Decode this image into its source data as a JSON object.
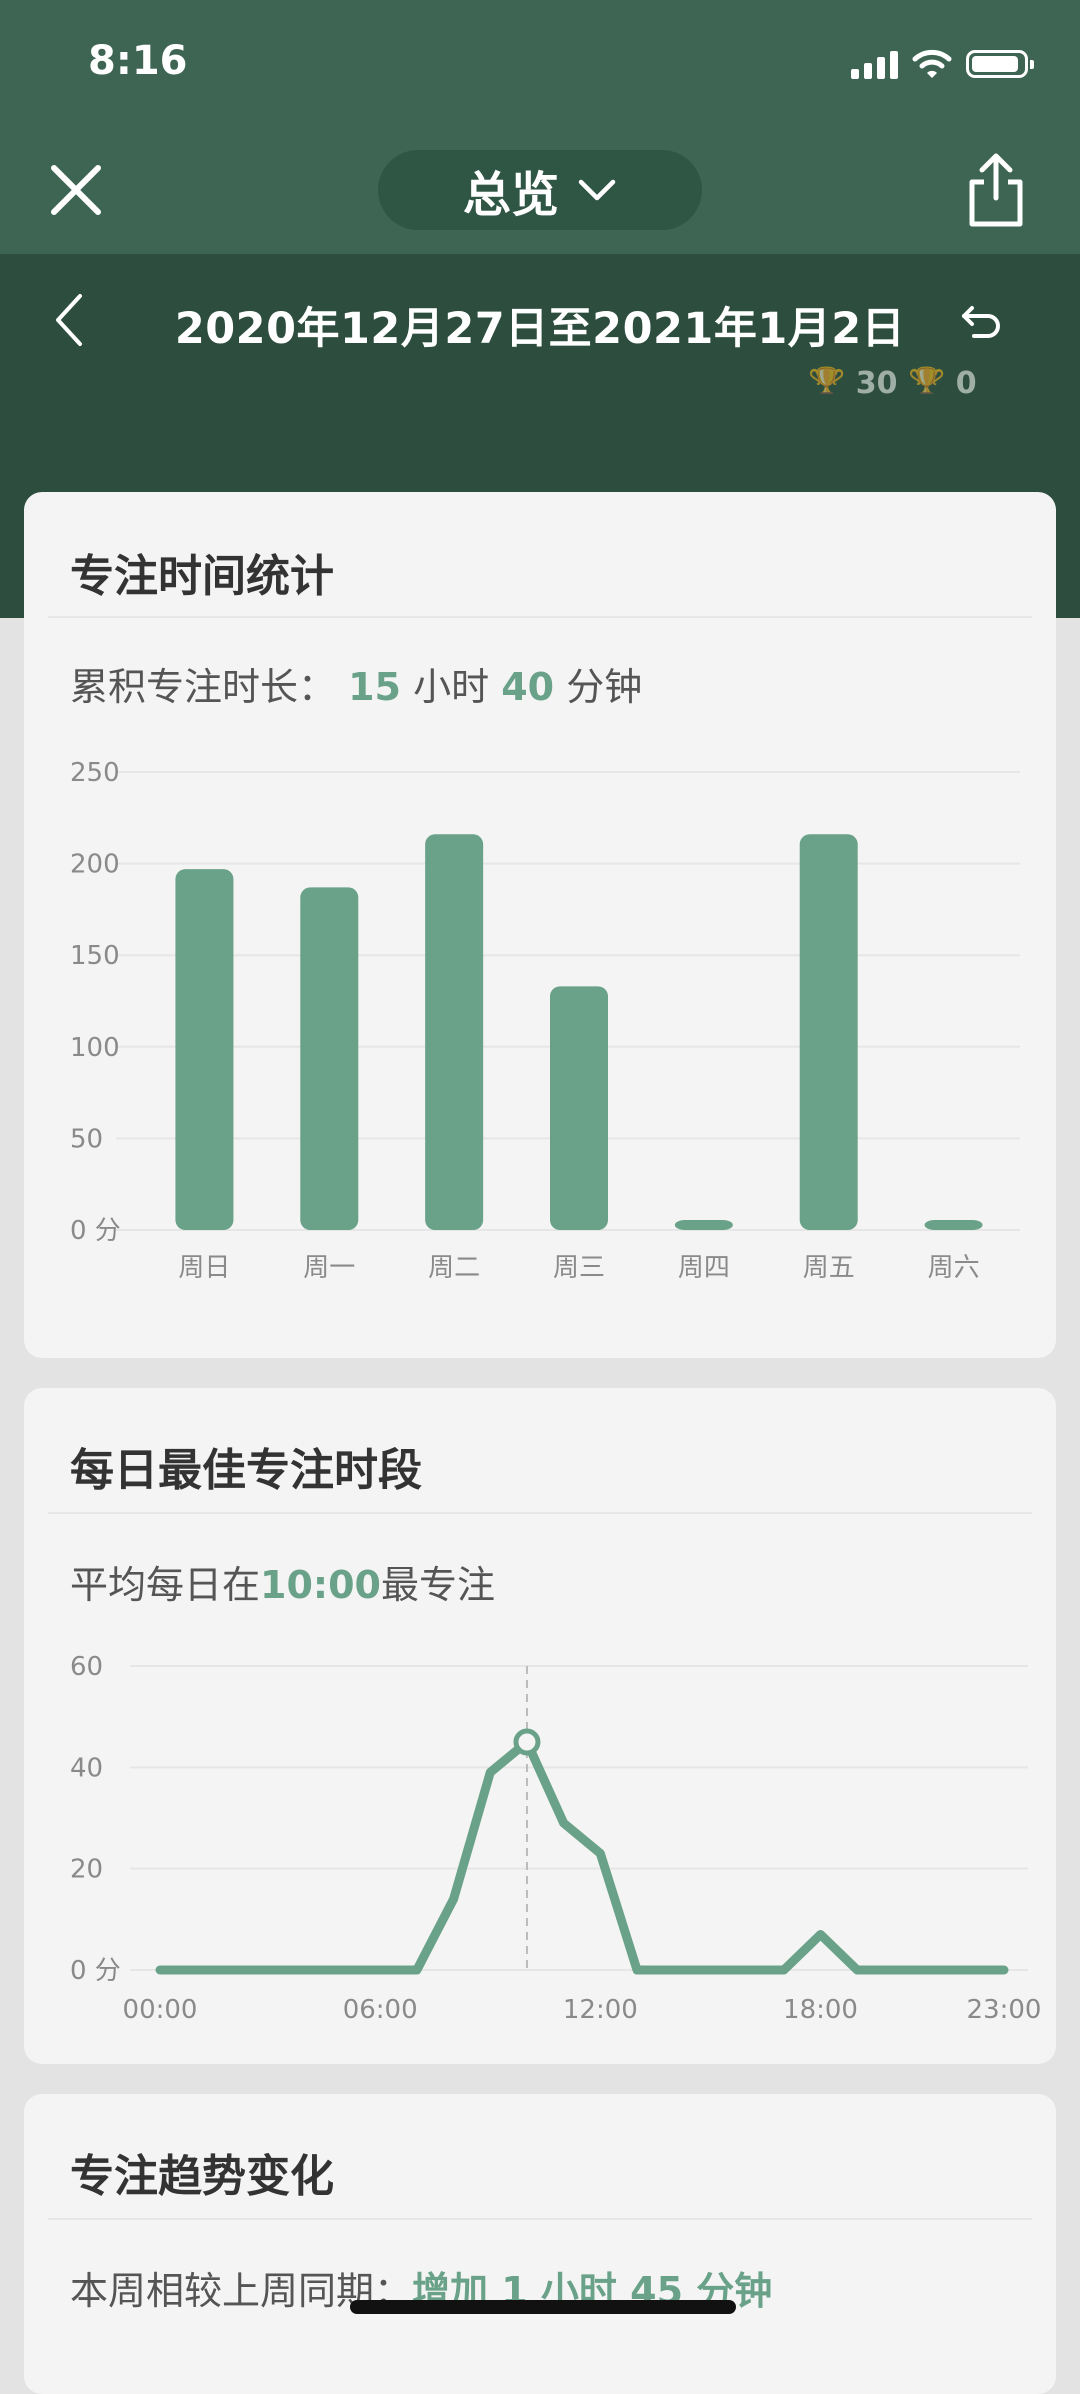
{
  "status_bar": {
    "time": "8:16"
  },
  "nav": {
    "title": "总览"
  },
  "date_range": {
    "label": "2020年12月27日至2021年1月2日"
  },
  "ghost_text": "🏆 30 🏆 0",
  "focus_stats": {
    "title": "专注时间统计",
    "summary_prefix": "累积专注时长：",
    "hours": "15",
    "hours_unit": "小时",
    "minutes": "40",
    "minutes_unit": "分钟"
  },
  "best_time": {
    "title": "每日最佳专注时段",
    "summary_prefix": "平均每日在",
    "time": "10:00",
    "summary_suffix": "最专注"
  },
  "trend": {
    "title": "专注趋势变化",
    "summary_prefix": "本周相较上周同期：",
    "change": "增加 1 小时 45 分钟"
  },
  "colors": {
    "accent": "#69a288",
    "header_dark": "#2d4d3e",
    "header_light": "#3e6553"
  },
  "chart_data": [
    {
      "type": "bar",
      "categories": [
        "周日",
        "周一",
        "周二",
        "周三",
        "周四",
        "周五",
        "周六"
      ],
      "values": [
        197,
        187,
        216,
        133,
        3,
        216,
        3
      ],
      "yticks": [
        "0 分",
        "50",
        "100",
        "150",
        "200",
        "250"
      ],
      "ylim": [
        0,
        250
      ],
      "grid": true
    },
    {
      "type": "line",
      "x": [
        "00:00",
        "01:00",
        "02:00",
        "03:00",
        "04:00",
        "05:00",
        "06:00",
        "07:00",
        "08:00",
        "09:00",
        "10:00",
        "11:00",
        "12:00",
        "13:00",
        "14:00",
        "15:00",
        "16:00",
        "17:00",
        "18:00",
        "19:00",
        "20:00",
        "21:00",
        "22:00",
        "23:00"
      ],
      "values": [
        0,
        0,
        0,
        0,
        0,
        0,
        0,
        0,
        14,
        39,
        45,
        29,
        23,
        0,
        0,
        0,
        0,
        0,
        7,
        0,
        0,
        0,
        0,
        0
      ],
      "xticks": [
        "00:00",
        "06:00",
        "12:00",
        "18:00",
        "23:00"
      ],
      "yticks": [
        "0 分",
        "20",
        "40",
        "60"
      ],
      "ylim": [
        0,
        60
      ],
      "highlight_x": "10:00",
      "grid": true
    }
  ]
}
